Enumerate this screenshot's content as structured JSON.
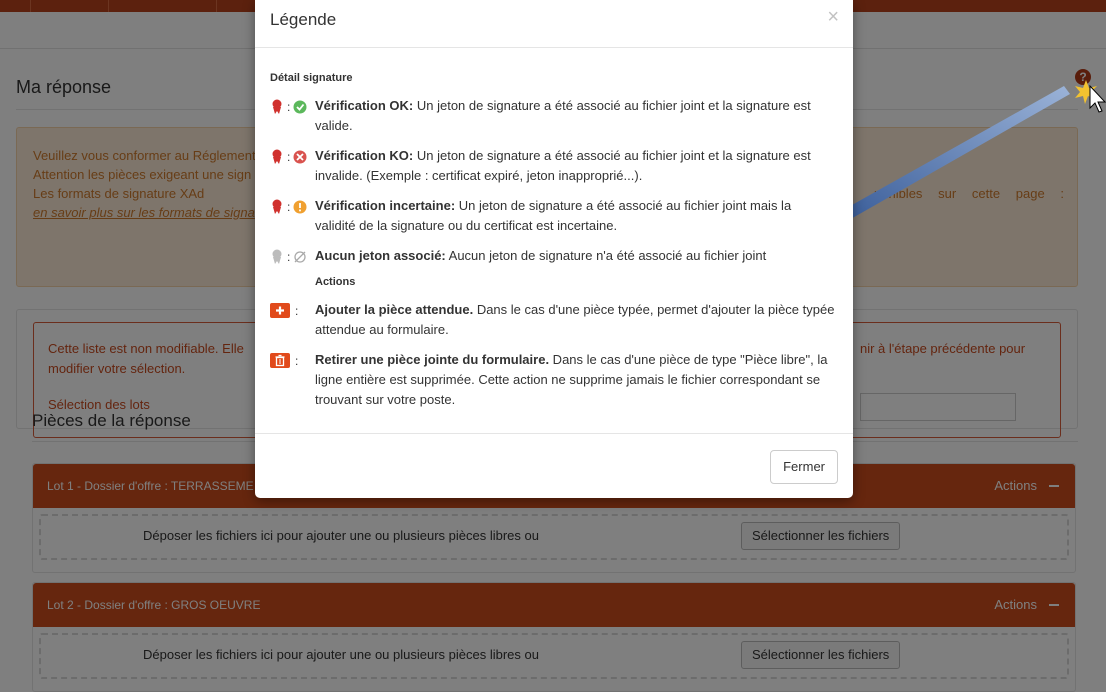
{
  "page": {
    "title": "Ma réponse",
    "help_icon": "?",
    "warning": {
      "line1": "Veuillez vous conformer au Réglement",
      "line2": "Attention les pièces exigeant une sign",
      "line3": "Les formats de signature XAd",
      "line3_right_a": "ponibles",
      "line3_right_b": "sur",
      "line3_right_c": "cette",
      "line3_right_d": "page",
      "line3_right_e": ":",
      "link": "en savoir plus sur les formats de signa"
    },
    "error": {
      "line1": "Cette liste est non modifiable. Elle",
      "line1_right": "nir à l'étape précédente pour",
      "line2": "modifier votre sélection.",
      "lots_label": "Sélection des lots"
    },
    "section_title": "Pièces de la réponse",
    "lots": [
      {
        "title": "Lot 1 - Dossier d'offre : TERRASSEME",
        "actions": "Actions",
        "drop_text": "Déposer les fichiers ici pour ajouter une ou plusieurs pièces libres ou",
        "select_button": "Sélectionner les fichiers"
      },
      {
        "title": "Lot 2 - Dossier d'offre : GROS OEUVRE",
        "actions": "Actions",
        "drop_text": "Déposer les fichiers ici pour ajouter une ou plusieurs pièces libres ou",
        "select_button": "Sélectionner les fichiers"
      }
    ]
  },
  "modal": {
    "title": "Légende",
    "close_icon": "×",
    "section_signature": "Détail signature",
    "section_actions": "Actions",
    "items": [
      {
        "icon": "ribbon-check-icon",
        "label": "Vérification OK:",
        "text": " Un jeton de signature a été associé au fichier joint et la signature est valide."
      },
      {
        "icon": "ribbon-cross-icon",
        "label": "Vérification KO:",
        "text": " Un jeton de signature a été associé au fichier joint et la signature est invalide. (Exemple : certificat expiré, jeton inapproprié...)."
      },
      {
        "icon": "ribbon-warning-icon",
        "label": "Vérification incertaine:",
        "text": " Un jeton de signature a été associé au fichier joint mais la validité de la signature ou du certificat est incertaine."
      },
      {
        "icon": "ribbon-none-icon",
        "label": "Aucun jeton associé:",
        "text": " Aucun jeton de signature n'a été associé au fichier joint"
      }
    ],
    "actions": [
      {
        "icon": "plus-icon",
        "label": "Ajouter la pièce attendue.",
        "text": " Dans le cas d'une pièce typée, permet d'ajouter la pièce typée attendue au formulaire."
      },
      {
        "icon": "trash-icon",
        "label": "Retirer une pièce jointe du formulaire.",
        "text": " Dans le cas d'une pièce de type \"Pièce libre\", la ligne entière est supprimée. Cette action ne supprime jamais le fichier correspondant se trouvant sur votre poste."
      }
    ],
    "colon": ":",
    "close_button": "Fermer"
  },
  "colors": {
    "brand": "#cc4d1c",
    "ok": "#5cb85c",
    "ko": "#d9534f",
    "warn": "#f0ad4e",
    "arrow": "#2a4f8f"
  }
}
